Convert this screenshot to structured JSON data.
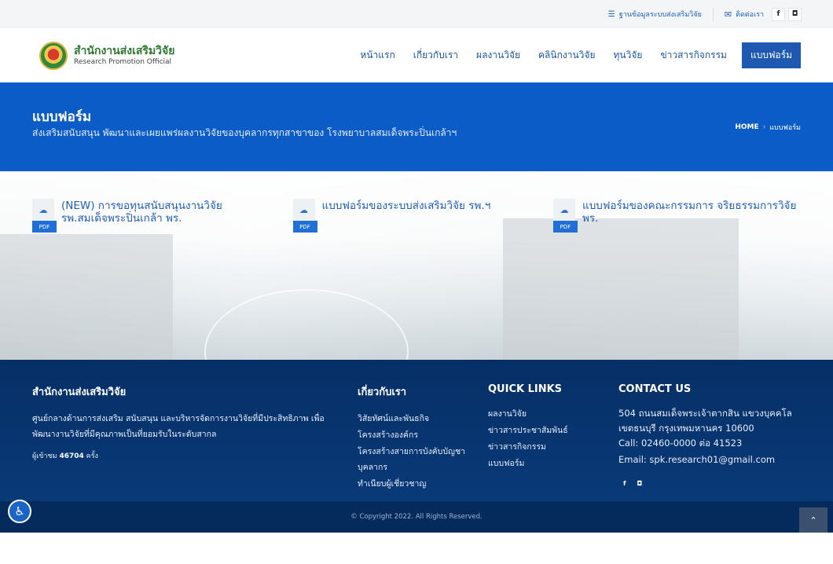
{
  "topbar": {
    "database_link": "ฐานข้อมูลระบบส่งเสริมวิจัย",
    "contact_link": "ติดต่อเรา",
    "facebook": "f",
    "line": "◘"
  },
  "header": {
    "logo_th": "สำนักงานส่งเสริมวิจัย",
    "logo_en": "Research Promotion Official",
    "nav": [
      {
        "label": "หน้าแรก"
      },
      {
        "label": "เกี่ยวกับเรา"
      },
      {
        "label": "ผลงานวิจัย"
      },
      {
        "label": "คลินิกงานวิจัย"
      },
      {
        "label": "ทุนวิจัย"
      },
      {
        "label": "ข่าวสารกิจกรรม"
      },
      {
        "label": "แบบฟอร์ม"
      }
    ]
  },
  "banner": {
    "title": "แบบฟอร์ม",
    "subtitle": "ส่งเสริมสนับสนุน พัฒนาและเผยแพร่ผลงานวิจัยของบุคลากรทุกสาขาของ โรงพยาบาลสมเด็จพระปิ่นเกล้าฯ",
    "breadcrumb_home": "HOME",
    "breadcrumb_arrow": "›",
    "breadcrumb_current": "แบบฟอร์ม"
  },
  "forms": [
    {
      "title": "(NEW) การขอทุนสนับสนุนงานวิจัย รพ.สมเด็จพระปิ่นเกล้า พร.",
      "badge": "PDF"
    },
    {
      "title": "แบบฟอร์มของระบบส่งเสริมวิจัย รพ.ฯ",
      "badge": "PDF"
    },
    {
      "title": "แบบฟอร์มของคณะกรรมการ จริยธรรมการวิจัย พร.",
      "badge": "PDF"
    }
  ],
  "footer": {
    "about": {
      "title": "สำนักงานส่งเสริมวิจัย",
      "desc": "ศูนย์กลางด้านการส่งเสริม สนับสนุน และบริหารจัดการงานวิจัยที่มีประสิทธิภาพ เพื่อพัฒนางานวิจัยที่มีคุณภาพเป็นที่ยอมรับในระดับสากล",
      "visitors_label": "ผู้เข้าชม",
      "visitors_count": "46704",
      "visitors_unit": "ครั้ง"
    },
    "about_us": {
      "title": "เกี่ยวกับเรา",
      "links": [
        "วิสัยทัศน์และพันธกิจ",
        "โครงสร้างองค์กร",
        "โครงสร้างสายการบังคับบัญชา",
        "บุคลากร",
        "ทำเนียบผู้เชี่ยวชาญ"
      ]
    },
    "quick_links": {
      "title": "QUICK LINKS",
      "links": [
        "ผลงานวิจัย",
        "ข่าวสารประชาสัมพันธ์",
        "ข่าวสารกิจกรรม",
        "แบบฟอร์ม"
      ]
    },
    "contact": {
      "title": "CONTACT US",
      "address": "504 ถนนสมเด็จพระเจ้าตากสิน แขวงบุคคโล เขตธนบุรี กรุงเทพมหานคร 10600",
      "call": "Call: 02460-0000 ต่อ 41523",
      "email": "Email: spk.research01@gmail.com",
      "facebook": "f",
      "line": "◘"
    },
    "copyright": "© Copyright 2022. All Rights Reserved."
  }
}
